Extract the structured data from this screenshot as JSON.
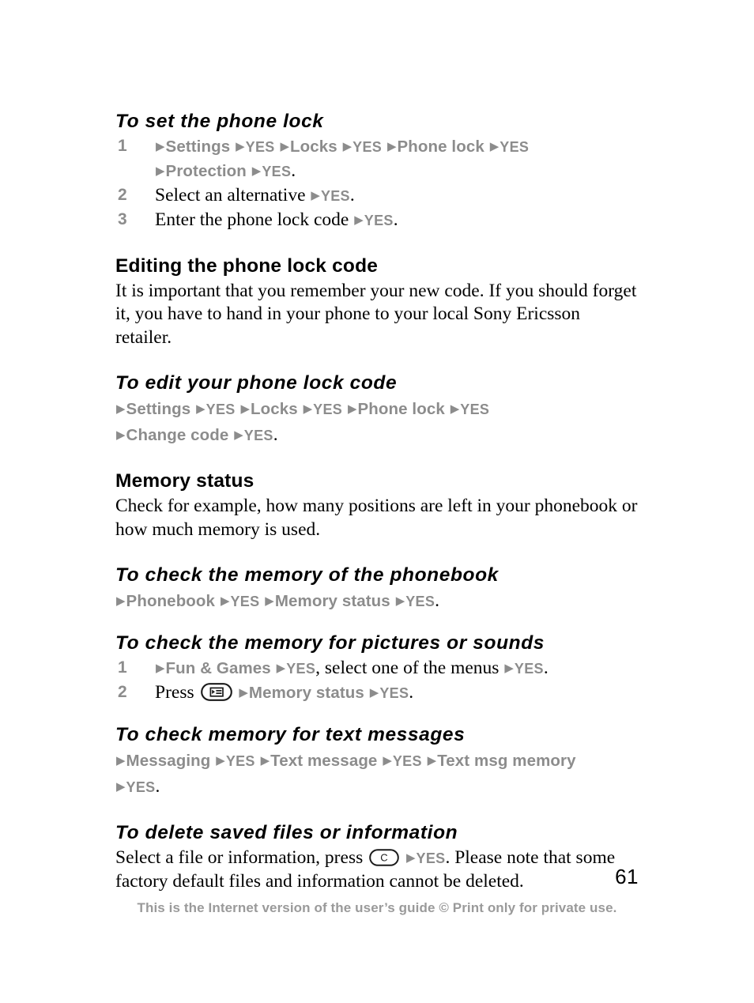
{
  "document": {
    "page_number": "61",
    "footer_note": "This is the Internet version of the user’s guide © Print only for private use."
  },
  "colors": {
    "menu_path_gray": "#8c8c8c",
    "footer_gray": "#9a9a9a",
    "body_black": "#000000"
  },
  "icons": {
    "menu_key": "menu-key-icon",
    "clear_key": "clear-key-icon",
    "clear_key_label": "C",
    "arrow": "▶"
  },
  "sections": [
    {
      "id": "set-phone-lock",
      "heading": "To set the phone lock",
      "heading_style": "italic",
      "steps": [
        {
          "number": "1",
          "line1": {
            "a1": "▶",
            "t1": "Settings",
            "a2": "▶",
            "t2": "YES",
            "a3": "▶",
            "t3": "Locks",
            "a4": "▶",
            "t4": "YES",
            "a5": "▶",
            "t5": "Phone lock",
            "a6": "▶",
            "t6": "YES"
          },
          "line2": {
            "a1": "▶",
            "t1": "Protection",
            "a2": "▶",
            "t2": "YES",
            "period": "."
          }
        },
        {
          "number": "2",
          "text_before": "Select an alternative",
          "arrow": "▶",
          "menu": "YES",
          "period": "."
        },
        {
          "number": "3",
          "text_before": "Enter the phone lock code",
          "arrow": "▶",
          "menu": "YES",
          "period": "."
        }
      ]
    },
    {
      "id": "editing-phone-lock-code",
      "heading": "Editing the phone lock code",
      "heading_style": "plain",
      "paragraph": "It is important that you remember your new code. If you should forget it, you have to hand in your phone to your local Sony Ericsson retailer."
    },
    {
      "id": "edit-your-phone-lock-code",
      "heading": "To edit your phone lock code",
      "heading_style": "italic",
      "path_line1": {
        "a1": "▶",
        "t1": "Settings",
        "a2": "▶",
        "t2": "YES",
        "a3": "▶",
        "t3": "Locks",
        "a4": "▶",
        "t4": "YES",
        "a5": "▶",
        "t5": "Phone lock",
        "a6": "▶",
        "t6": "YES"
      },
      "path_line2": {
        "a1": "▶",
        "t1": "Change code",
        "a2": "▶",
        "t2": "YES",
        "period": "."
      }
    },
    {
      "id": "memory-status",
      "heading": "Memory status",
      "heading_style": "plain",
      "paragraph": "Check for example, how many positions are left in your phonebook or how much memory is used."
    },
    {
      "id": "check-memory-phonebook",
      "heading": "To check the memory of the phonebook",
      "heading_style": "italic",
      "path_line1": {
        "a1": "▶",
        "t1": "Phonebook",
        "a2": "▶",
        "t2": "YES",
        "a3": "▶",
        "t3": "Memory status",
        "a4": "▶",
        "t4": "YES",
        "period": "."
      }
    },
    {
      "id": "check-memory-pictures-sounds",
      "heading": "To check the memory for pictures or sounds",
      "heading_style": "italic",
      "steps": [
        {
          "number": "1",
          "a1": "▶",
          "t1": "Fun & Games",
          "a2": "▶",
          "t2": "YES",
          "mid_text": ", select one of the menus ",
          "a3": "▶",
          "t3": "YES",
          "period": "."
        },
        {
          "number": "2",
          "press_label": "Press",
          "key_icon": "menu-key-icon",
          "a1": "▶",
          "t1": "Memory status",
          "a2": "▶",
          "t2": "YES",
          "period": "."
        }
      ]
    },
    {
      "id": "check-memory-text-messages",
      "heading": "To check memory for text messages",
      "heading_style": "italic",
      "path_line1": {
        "a1": "▶",
        "t1": "Messaging",
        "a2": "▶",
        "t2": "YES",
        "a3": "▶",
        "t3": "Text message",
        "a4": "▶",
        "t4": "YES",
        "a5": "▶",
        "t5": "Text msg memory"
      },
      "path_line2": {
        "a1": "▶",
        "t1": "YES",
        "period": "."
      }
    },
    {
      "id": "delete-saved-files",
      "heading": "To delete saved files or information",
      "heading_style": "italic",
      "para_before": "Select a file or information, press ",
      "key_icon": "clear-key-icon",
      "arrow": "▶",
      "menu": "YES",
      "para_after": ". Please note that some factory default files and information cannot be deleted."
    }
  ]
}
